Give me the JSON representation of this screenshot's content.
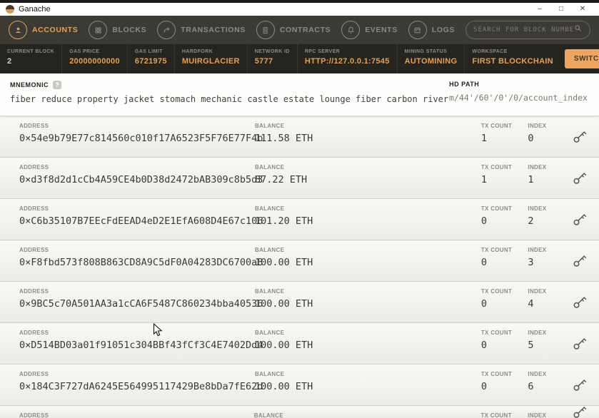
{
  "window": {
    "title": "Ganache",
    "controls": {
      "minimize": "–",
      "maximize": "□",
      "close": "✕"
    }
  },
  "nav": {
    "items": [
      {
        "label": "ACCOUNTS",
        "icon": "person-icon",
        "active": true
      },
      {
        "label": "BLOCKS",
        "icon": "blocks-icon",
        "active": false
      },
      {
        "label": "TRANSACTIONS",
        "icon": "transactions-icon",
        "active": false
      },
      {
        "label": "CONTRACTS",
        "icon": "contract-icon",
        "active": false
      },
      {
        "label": "EVENTS",
        "icon": "bell-icon",
        "active": false
      },
      {
        "label": "LOGS",
        "icon": "logs-icon",
        "active": false
      }
    ],
    "search": {
      "placeholder": "SEARCH FOR BLOCK NUMBERS OR TX HASHES",
      "icon": "search-icon"
    }
  },
  "status": {
    "items": [
      {
        "label": "CURRENT BLOCK",
        "value": "2"
      },
      {
        "label": "GAS PRICE",
        "value": "20000000000"
      },
      {
        "label": "GAS LIMIT",
        "value": "6721975"
      },
      {
        "label": "HARDFORK",
        "value": "MUIRGLACIER"
      },
      {
        "label": "NETWORK ID",
        "value": "5777"
      },
      {
        "label": "RPC SERVER",
        "value": "HTTP://127.0.0.1:7545"
      },
      {
        "label": "MINING STATUS",
        "value": "AUTOMINING"
      }
    ],
    "workspace": {
      "label": "WORKSPACE",
      "value": "FIRST BLOCKCHAIN"
    },
    "switch_label": "SWITCH",
    "settings_icon": "gear-icon"
  },
  "mnemonic": {
    "label": "MNEMONIC",
    "help": "?",
    "phrase": "fiber reduce property jacket stomach mechanic castle estate lounge fiber carbon river",
    "hd_path_label": "HD PATH",
    "hd_path": "m/44'/60'/0'/0/account_index"
  },
  "accounts": {
    "column_labels": {
      "address": "ADDRESS",
      "balance": "BALANCE",
      "tx_count": "TX COUNT",
      "index": "INDEX"
    },
    "key_icon": "key-icon",
    "rows": [
      {
        "address": "0×54e9b79E77c814560c010f17A6523F5F76E77F4b",
        "balance": "111.58 ETH",
        "tx_count": "1",
        "index": "0"
      },
      {
        "address": "0×d3f8d2d1cCb4A59CE4b0D38d2472bAB309c8b5d3",
        "balance": "87.22 ETH",
        "tx_count": "1",
        "index": "1"
      },
      {
        "address": "0×C6b35107B7EEcFdEEAD4eD2E1EfA608D4E67c106",
        "balance": "101.20 ETH",
        "tx_count": "0",
        "index": "2"
      },
      {
        "address": "0×F8fbd573f808B863CD8A9C5dF0A04283DC6700a8",
        "balance": "100.00 ETH",
        "tx_count": "0",
        "index": "3"
      },
      {
        "address": "0×9BC5c70A501AA3a1cCA6F5487C860234bba40536",
        "balance": "100.00 ETH",
        "tx_count": "0",
        "index": "4"
      },
      {
        "address": "0×D514BD03a01f91051c304BBf43fCf3C4E7402Dd4",
        "balance": "100.00 ETH",
        "tx_count": "0",
        "index": "5"
      },
      {
        "address": "0×184C3F727dA6245E564995117429Be8bDa7fE62d",
        "balance": "100.00 ETH",
        "tx_count": "0",
        "index": "6"
      },
      {
        "address": "",
        "balance": "",
        "tx_count": "",
        "index": ""
      }
    ]
  },
  "colors": {
    "accent_orange": "#e2a25c",
    "button_orange": "#eda55f",
    "nav_bg": "#3b3a35",
    "status_bg": "#25241f",
    "inactive_gray": "#8b8a84"
  }
}
